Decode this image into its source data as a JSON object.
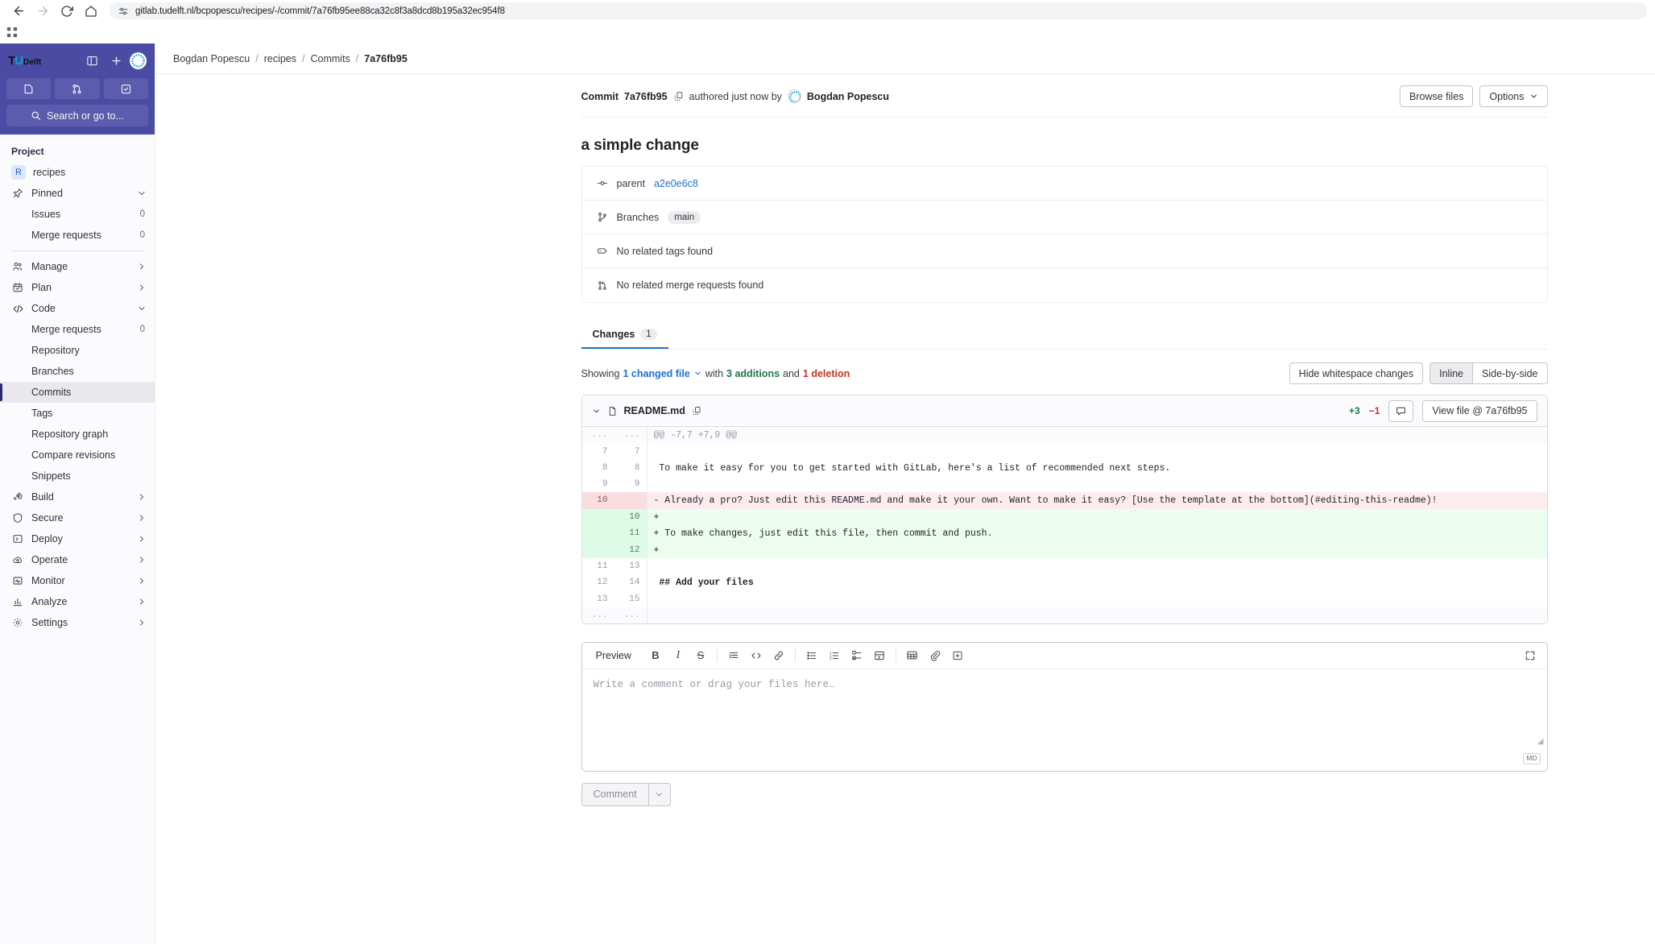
{
  "browser": {
    "url": "gitlab.tudelft.nl/bcpopescu/recipes/-/commit/7a76fb95ee88ca32c8f3a8dcd8b195a32ec954f8",
    "back_icon": "back-arrow-icon",
    "forward_icon": "forward-arrow-icon",
    "reload_icon": "reload-icon",
    "home_icon": "home-icon",
    "site_settings_icon": "site-settings-icon",
    "apps_icon": "apps-grid-icon"
  },
  "sidebar": {
    "brand": {
      "t": "T",
      "u": "U",
      "word": "Delft"
    },
    "toggle_icon": "panel-toggle-icon",
    "create_icon": "plus-icon",
    "avatar_icon": "user-avatar",
    "quick_actions": [
      {
        "name": "issues-shortcut",
        "icon": "issue-icon"
      },
      {
        "name": "merge-requests-shortcut",
        "icon": "merge-request-icon"
      },
      {
        "name": "todos-shortcut",
        "icon": "todo-check-icon"
      }
    ],
    "search_placeholder": "Search or go to...",
    "search_icon": "search-icon",
    "section_title": "Project",
    "project": {
      "initial": "R",
      "name": "recipes"
    },
    "groups": [
      {
        "label": "Pinned",
        "icon": "pin-icon",
        "expanded": true,
        "chevron": "chevron-down-icon",
        "children": [
          {
            "label": "Issues",
            "count": "0"
          },
          {
            "label": "Merge requests",
            "count": "0"
          }
        ]
      }
    ],
    "nav": [
      {
        "label": "Manage",
        "icon": "users-icon",
        "chevron": "chevron-right-icon",
        "children": []
      },
      {
        "label": "Plan",
        "icon": "calendar-icon",
        "chevron": "chevron-right-icon",
        "children": []
      },
      {
        "label": "Code",
        "icon": "code-icon",
        "chevron": "chevron-down-icon",
        "children": [
          {
            "label": "Merge requests",
            "count": "0"
          },
          {
            "label": "Repository"
          },
          {
            "label": "Branches"
          },
          {
            "label": "Commits",
            "active": true
          },
          {
            "label": "Tags"
          },
          {
            "label": "Repository graph"
          },
          {
            "label": "Compare revisions"
          },
          {
            "label": "Snippets"
          }
        ]
      },
      {
        "label": "Build",
        "icon": "rocket-icon",
        "chevron": "chevron-right-icon",
        "children": []
      },
      {
        "label": "Secure",
        "icon": "shield-icon",
        "chevron": "chevron-right-icon",
        "children": []
      },
      {
        "label": "Deploy",
        "icon": "deploy-icon",
        "chevron": "chevron-right-icon",
        "children": []
      },
      {
        "label": "Operate",
        "icon": "cloud-gear-icon",
        "chevron": "chevron-right-icon",
        "children": []
      },
      {
        "label": "Monitor",
        "icon": "monitor-icon",
        "chevron": "chevron-right-icon",
        "children": []
      },
      {
        "label": "Analyze",
        "icon": "chart-icon",
        "chevron": "chevron-right-icon",
        "children": []
      },
      {
        "label": "Settings",
        "icon": "gear-icon",
        "chevron": "chevron-right-icon",
        "children": []
      }
    ]
  },
  "breadcrumb": [
    {
      "label": "Bogdan Popescu"
    },
    {
      "label": "recipes"
    },
    {
      "label": "Commits"
    },
    {
      "label": "7a76fb95",
      "last": true
    }
  ],
  "commit": {
    "prefix": "Commit",
    "short_sha": "7a76fb95",
    "copy_icon": "copy-to-clipboard-icon",
    "authored_text": "authored just now by",
    "author": "Bogdan Popescu",
    "title": "a simple change",
    "browse_files_label": "Browse files",
    "options_label": "Options",
    "options_chevron": "chevron-down-icon",
    "rows": [
      {
        "icon": "commit-node-icon",
        "label": "parent",
        "link": "a2e0e6c8"
      },
      {
        "icon": "branch-icon",
        "label": "Branches",
        "badge": "main"
      },
      {
        "icon": "tag-icon",
        "label": "No related tags found"
      },
      {
        "icon": "merge-request-icon",
        "label": "No related merge requests found"
      }
    ]
  },
  "changes": {
    "tab_label": "Changes",
    "tab_count": "1",
    "showing_prefix": "Showing",
    "changed_files_link": "1 changed file",
    "with_text": "with",
    "additions": "3 additions",
    "and_text": "and",
    "deletions": "1 deletion",
    "hide_whitespace_label": "Hide whitespace changes",
    "inline_label": "Inline",
    "side_by_side_label": "Side-by-side"
  },
  "diff": {
    "collapse_icon": "chevron-down-icon",
    "file_icon": "document-icon",
    "file_name": "README.md",
    "copy_path_icon": "copy-path-icon",
    "additions": "+3",
    "deletions": "−1",
    "comment_icon": "comment-icon",
    "view_file_label": "View file @ 7a76fb95",
    "lines": [
      {
        "type": "meta",
        "old": "...",
        "new": "...",
        "code": "@@ -7,7 +7,9 @@"
      },
      {
        "type": "ctx",
        "old": "7",
        "new": "7",
        "code": ""
      },
      {
        "type": "ctx",
        "old": "8",
        "new": "8",
        "code": " To make it easy for you to get started with GitLab, here's a list of recommended next steps."
      },
      {
        "type": "ctx",
        "old": "9",
        "new": "9",
        "code": ""
      },
      {
        "type": "del",
        "old": "10",
        "new": "",
        "code": "- Already a pro? Just edit this README.md and make it your own. Want to make it easy? [Use the template at the bottom](#editing-this-readme)!"
      },
      {
        "type": "add",
        "old": "",
        "new": "10",
        "code": "+"
      },
      {
        "type": "add",
        "old": "",
        "new": "11",
        "code": "+ To make changes, just edit this file, then commit and push."
      },
      {
        "type": "add",
        "old": "",
        "new": "12",
        "code": "+"
      },
      {
        "type": "ctx",
        "old": "11",
        "new": "13",
        "code": ""
      },
      {
        "type": "ctx",
        "old": "12",
        "new": "14",
        "code": " ## Add your files"
      },
      {
        "type": "ctx",
        "old": "13",
        "new": "15",
        "code": ""
      },
      {
        "type": "meta",
        "old": "...",
        "new": "...",
        "code": ""
      }
    ]
  },
  "comment_box": {
    "preview_label": "Preview",
    "toolbar": [
      {
        "name": "bold-icon",
        "glyph": "B"
      },
      {
        "name": "italic-icon",
        "glyph": "I"
      },
      {
        "name": "strikethrough-icon",
        "glyph": "S"
      },
      {
        "name": "blockquote-icon",
        "glyph": "”"
      },
      {
        "name": "code-icon",
        "glyph": "<>"
      },
      {
        "name": "link-icon",
        "glyph": "🔗"
      },
      {
        "name": "bulleted-list-icon",
        "glyph": "☰"
      },
      {
        "name": "numbered-list-icon",
        "glyph": "1."
      },
      {
        "name": "task-list-icon",
        "glyph": "☑"
      },
      {
        "name": "collapsible-section-icon",
        "glyph": "▣"
      },
      {
        "name": "table-icon",
        "glyph": "▦"
      },
      {
        "name": "attach-file-icon",
        "glyph": "📎"
      },
      {
        "name": "insert-comment-template-icon",
        "glyph": "⎘"
      }
    ],
    "fullscreen_icon": "fullscreen-icon",
    "placeholder": "Write a comment or drag your files here…",
    "markdown_badge": "MD",
    "submit_label": "Comment",
    "submit_chevron": "chevron-down-icon"
  }
}
